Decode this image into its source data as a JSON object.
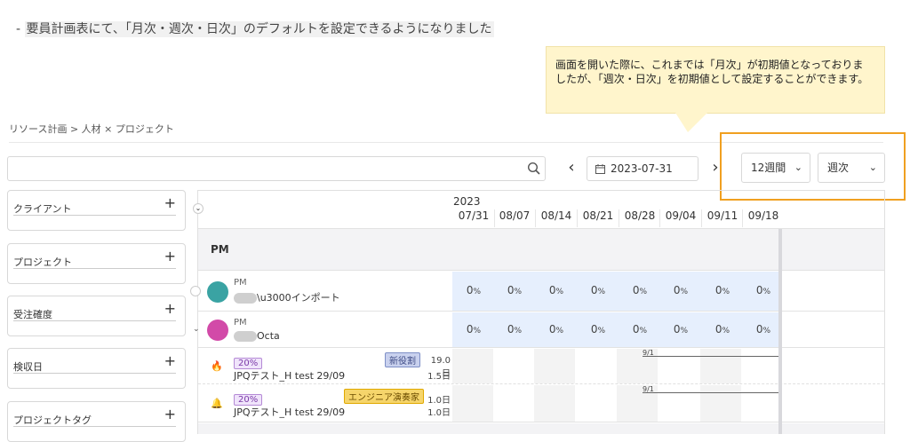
{
  "note": {
    "prefix": "-",
    "text": "要員計画表にて、「月次・週次・日次」のデフォルトを設定できるようになりました"
  },
  "callout": {
    "text": "画面を開いた際に、これまでは「月次」が初期値となっておりましたが、「週次・日次」を初期値として設定することができます。"
  },
  "breadcrumb": "リソース計画 > 人材 × プロジェクト",
  "search": {
    "placeholder": "",
    "value": ""
  },
  "toolbar": {
    "prev": "‹",
    "next": "›",
    "date": "2023-07-31",
    "range": "12週間",
    "granularity": "週次"
  },
  "filters": [
    {
      "label": "クライアント"
    },
    {
      "label": "プロジェクト"
    },
    {
      "label": "受注確度"
    },
    {
      "label": "検収日"
    },
    {
      "label": "プロジェクトタグ"
    }
  ],
  "timeline": {
    "year": "2023",
    "columns": [
      "07/31",
      "08/07",
      "08/14",
      "08/21",
      "08/28",
      "09/04",
      "09/11",
      "09/18"
    ]
  },
  "section": {
    "label": "PM"
  },
  "people": [
    {
      "role": "PM",
      "name": "\\u3000インポート",
      "avatar_color": "#3aa3a3",
      "values": [
        "0",
        "0",
        "0",
        "0",
        "0",
        "0",
        "0",
        "0"
      ],
      "unit": "%"
    },
    {
      "role": "PM",
      "name": "Octa",
      "avatar_color": "#d24aa8",
      "values": [
        "0",
        "0",
        "0",
        "0",
        "0",
        "0",
        "0",
        "0"
      ],
      "unit": "%"
    }
  ],
  "assignments": [
    {
      "icon": "🔥",
      "pct": "20%",
      "role_tag": "新役割",
      "role_color": "#7e8fc6",
      "title": "JPQテスト_H test 29/09",
      "days_top": "19.0日",
      "days_bottom": "1.5日",
      "marker": "9/1"
    },
    {
      "icon": "🔔",
      "pct": "20%",
      "role_tag": "エンジニア演奏家",
      "role_color": "#e0a800",
      "title": "JPQテスト_H test 29/09",
      "days_top": "1.0日",
      "days_bottom": "1.0日",
      "marker": "9/1"
    }
  ],
  "colors": {
    "highlight": "#f0a020",
    "callout_bg": "#fff5cc",
    "blue_row": "#e6effd"
  }
}
